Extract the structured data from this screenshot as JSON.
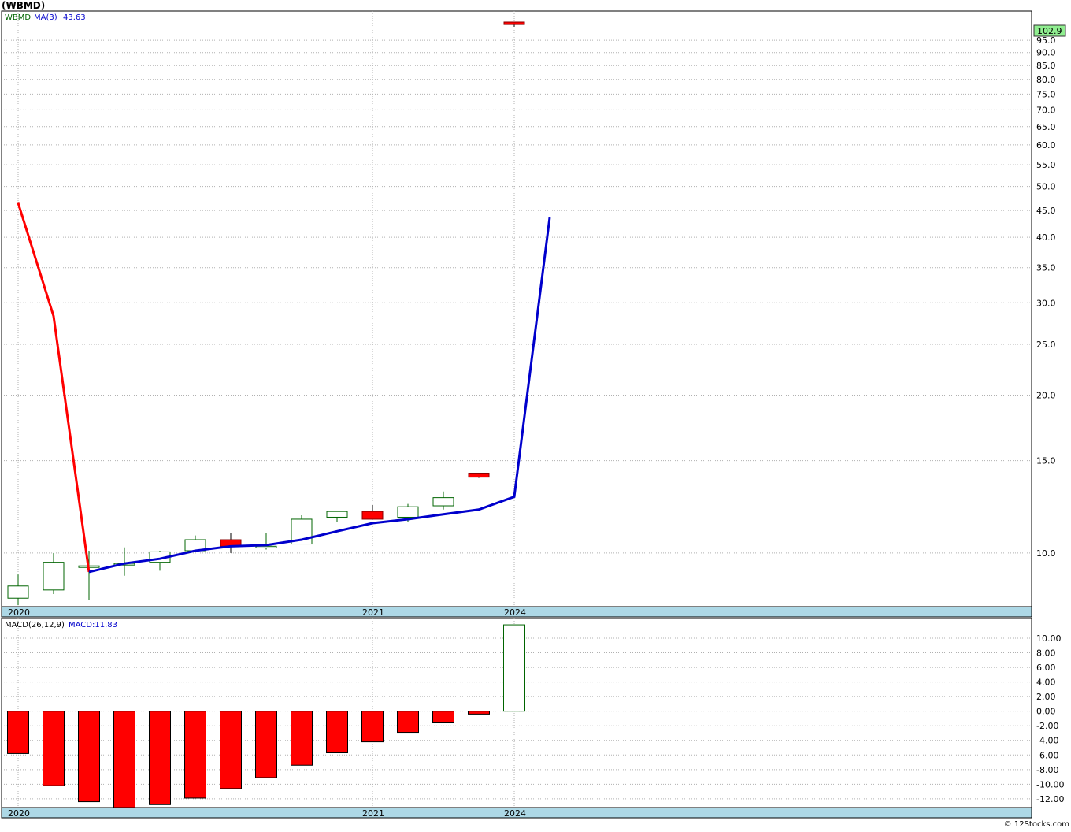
{
  "title": "(WBMD)",
  "credit": "© 12Stocks.com",
  "colors": {
    "up": "#006400",
    "down": "#ff0000",
    "ma": "#0000cc",
    "ma_pre": "#ff0000",
    "axis_band": "#add8e6",
    "last_price_bg": "#90ee90"
  },
  "chart_data": [
    {
      "type": "candlestick",
      "legend": {
        "symbol": "WBMD",
        "ma_label": "MA(3)",
        "ma_value": "43.63"
      },
      "last_price_label": "102.9",
      "y_scale": "log",
      "ylim": [
        7.9,
        108
      ],
      "y_ticks": [
        10.0,
        15.0,
        20.0,
        25.0,
        30.0,
        35.0,
        40.0,
        45.0,
        50.0,
        55.0,
        60.0,
        65.0,
        70.0,
        75.0,
        80.0,
        85.0,
        90.0,
        95.0
      ],
      "x_labels": [
        {
          "label": "2020",
          "index": 0
        },
        {
          "label": "2021",
          "index": 10
        },
        {
          "label": "2024",
          "index": 14
        }
      ],
      "candles": [
        {
          "open": 8.2,
          "high": 9.1,
          "low": 7.95,
          "close": 8.65
        },
        {
          "open": 8.5,
          "high": 10.0,
          "low": 8.35,
          "close": 9.6
        },
        {
          "open": 9.42,
          "high": 10.1,
          "low": 8.15,
          "close": 9.45
        },
        {
          "open": 9.5,
          "high": 10.25,
          "low": 9.05,
          "close": 9.55
        },
        {
          "open": 9.6,
          "high": 10.1,
          "low": 9.25,
          "close": 10.05
        },
        {
          "open": 10.1,
          "high": 10.8,
          "low": 10.1,
          "close": 10.6
        },
        {
          "open": 10.6,
          "high": 10.9,
          "low": 10.0,
          "close": 10.3
        },
        {
          "open": 10.25,
          "high": 10.9,
          "low": 10.15,
          "close": 10.3
        },
        {
          "open": 10.4,
          "high": 11.8,
          "low": 10.4,
          "close": 11.6
        },
        {
          "open": 11.7,
          "high": 12.0,
          "low": 11.45,
          "close": 12.0
        },
        {
          "open": 12.0,
          "high": 12.35,
          "low": 11.65,
          "close": 11.6
        },
        {
          "open": 11.7,
          "high": 12.4,
          "low": 11.45,
          "close": 12.25
        },
        {
          "open": 12.3,
          "high": 13.1,
          "low": 12.1,
          "close": 12.75
        },
        {
          "open": 14.2,
          "high": 14.2,
          "low": 13.9,
          "close": 13.95
        },
        {
          "open": 102.9,
          "high": 102.9,
          "low": 100.8,
          "close": 101.8
        }
      ],
      "ma_pre": [
        {
          "index": 0,
          "value": 46.5
        },
        {
          "index": 1,
          "value": 28.3
        },
        {
          "index": 2,
          "value": 9.2
        }
      ],
      "ma": [
        9.2,
        9.55,
        9.75,
        10.1,
        10.3,
        10.35,
        10.6,
        11.0,
        11.4,
        11.6,
        11.85,
        12.1,
        12.8,
        43.63
      ]
    },
    {
      "type": "bar",
      "legend": {
        "label": "MACD(26,12,9)",
        "value_label": "MACD:11.83"
      },
      "ylim": [
        -13.2,
        12.7
      ],
      "y_ticks": [
        -12.0,
        -10.0,
        -8.0,
        -6.0,
        -4.0,
        -2.0,
        0.0,
        2.0,
        4.0,
        6.0,
        8.0,
        10.0
      ],
      "y_tick_labels": [
        "-12.00",
        "-10.00",
        "-8.00",
        "-6.00",
        "-4.00",
        "-2.00",
        "0.00",
        "2.00",
        "4.00",
        "6.00",
        "8.00",
        "10.00"
      ],
      "x_labels": [
        {
          "label": "2020",
          "index": 0
        },
        {
          "label": "2021",
          "index": 10
        },
        {
          "label": "2024",
          "index": 14
        }
      ],
      "values": [
        -5.8,
        -10.2,
        -12.4,
        -13.2,
        -12.8,
        -11.9,
        -10.6,
        -9.1,
        -7.4,
        -5.7,
        -4.2,
        -2.9,
        -1.6,
        -0.4,
        11.83
      ]
    }
  ]
}
